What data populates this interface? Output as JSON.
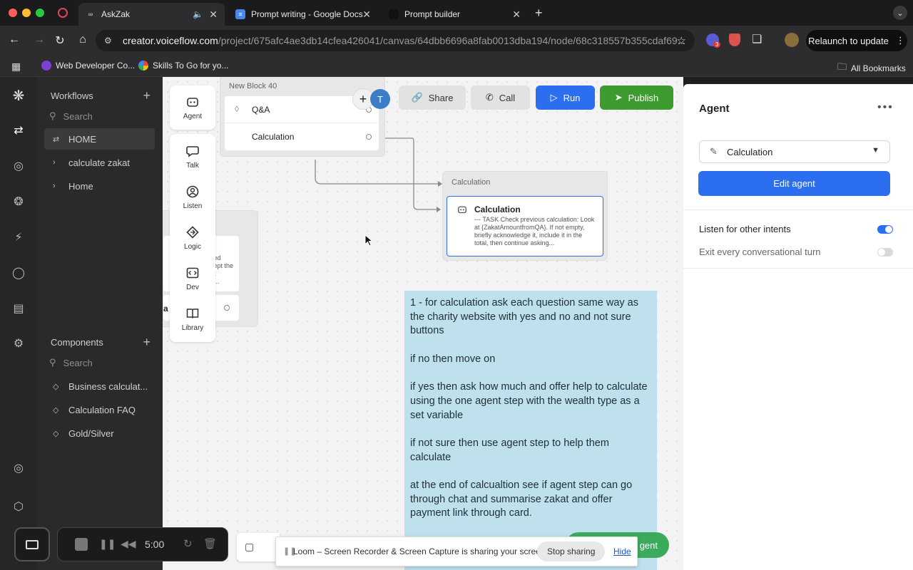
{
  "browser": {
    "tabs": [
      {
        "title": "AskZak"
      },
      {
        "title": "Prompt writing - Google Docs"
      },
      {
        "title": "Prompt builder"
      }
    ],
    "url_host": "creator.voiceflow.com",
    "url_path": "/project/675afc4ae3db14cfea426041/canvas/64dbb6696a8fab0013dba194/node/68c318557b355cdaf69...",
    "extension_badge": "3",
    "relaunch_label": "Relaunch to update",
    "bookmarks": [
      "Web Developer Co...",
      "Skills To Go for yo..."
    ],
    "all_bookmarks": "All Bookmarks"
  },
  "sidebar": {
    "workflows_label": "Workflows",
    "search_placeholder": "Search",
    "workflows": [
      {
        "label": "HOME",
        "active": true
      },
      {
        "label": "calculate zakat"
      },
      {
        "label": "Home"
      }
    ],
    "components_label": "Components",
    "components_search_placeholder": "Search",
    "components": [
      {
        "label": "Business calculat..."
      },
      {
        "label": "Calculation FAQ"
      },
      {
        "label": "Gold/Silver"
      }
    ]
  },
  "toolbox": {
    "agent": "Agent",
    "items": [
      "Talk",
      "Listen",
      "Logic",
      "Dev",
      "Library"
    ]
  },
  "canvas": {
    "block40": {
      "title": "New Block 40",
      "steps": [
        "Q&A",
        "Calculation"
      ]
    },
    "avatar_initial": "T",
    "buttons": {
      "share": "Share",
      "call": "Call",
      "run": "Run",
      "publish": "Publish"
    },
    "calc_block": {
      "title": "Calculation",
      "step_title": "Calculation",
      "step_desc": "--- TASK Check previous calculation: Look at {ZakatAmountfromQA}. If not empty, briefly acknowledge it, include it in the total, then continue asking..."
    },
    "partial_block": {
      "text": "sed\nkept the\nut\nd...",
      "edge": "a"
    },
    "note": {
      "paragraphs": [
        "1 - for calculation ask each question same way as the charity website with yes and no and not sure buttons",
        "if no then move on",
        "if yes then ask how much and offer help to calculate using the one agent step with the wealth type as a set variable",
        "if not sure then use agent step to help them calculate",
        "at the end of calcualtion see if agent step can go through chat and summarise zakat and offer payment link through card."
      ]
    },
    "green_pill_label": "gent"
  },
  "panel": {
    "title": "Agent",
    "selected_agent": "Calculation",
    "edit_label": "Edit agent",
    "toggles": [
      {
        "label": "Listen for other intents",
        "on": true
      },
      {
        "label": "Exit every conversational turn",
        "on": false
      }
    ]
  },
  "overlays": {
    "timer": "5:00",
    "share_message": "Loom – Screen Recorder & Screen Capture is sharing your screen.",
    "stop_sharing": "Stop sharing",
    "hide": "Hide"
  },
  "colors": {
    "accent": "#2b6ff0",
    "publish": "#3d9b2f",
    "note": "#bfe1ee",
    "toggle_on": "#2b6ff0"
  }
}
